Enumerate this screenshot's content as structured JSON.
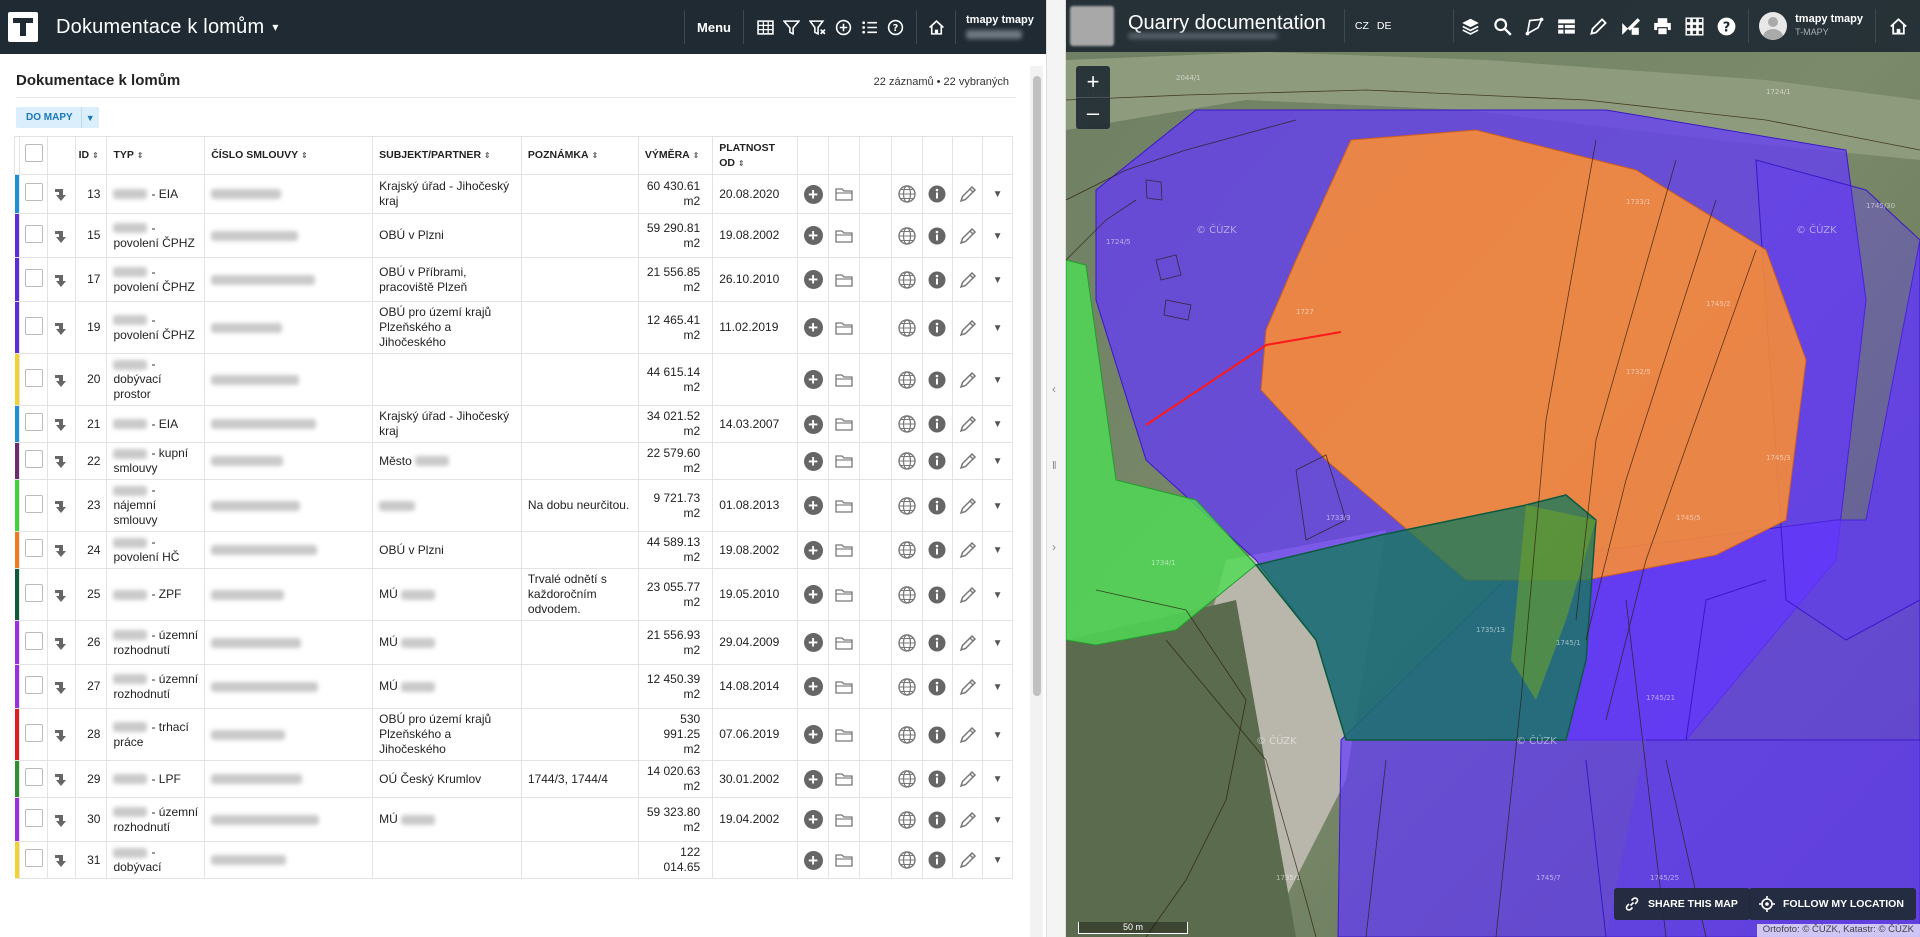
{
  "left_header": {
    "title": "Dokumentace k lomům",
    "menu_label": "Menu",
    "user_name": "tmapy tmapy"
  },
  "list": {
    "title": "Dokumentace k lomům",
    "count": "22 záznamů • 22 vybraných",
    "to_map_button": "DO MAPY"
  },
  "table": {
    "headers": {
      "id": "ID",
      "typ": "TYP",
      "cislo": "ČÍSLO SMLOUVY",
      "subjekt": "SUBJEKT/PARTNER",
      "poznamka": "POZNÁMKA",
      "vymera": "VÝMĚRA",
      "platnost": "PLATNOST OD"
    },
    "rows": [
      {
        "color": "#1e8ed6",
        "id": "13",
        "typ": "- EIA",
        "subjekt": "Krajský úřad - Jihočeský kraj",
        "poznamka": "",
        "vymera": "60 430.61 m2",
        "platnost": "20.08.2020"
      },
      {
        "color": "#5b2dd8",
        "id": "15",
        "typ": "- povolení ČPHZ",
        "subjekt": "OBÚ v Plzni",
        "poznamka": "",
        "vymera": "59 290.81 m2",
        "platnost": "19.08.2002"
      },
      {
        "color": "#5b2dd8",
        "id": "17",
        "typ": "- povolení ČPHZ",
        "subjekt": "OBÚ v Příbrami, pracoviště Plzeň",
        "poznamka": "",
        "vymera": "21 556.85 m2",
        "platnost": "26.10.2010"
      },
      {
        "color": "#5b2dd8",
        "id": "19",
        "typ": "- povolení ČPHZ",
        "subjekt": "OBÚ pro území krajů Plzeňského a Jihočeského",
        "poznamka": "",
        "vymera": "12 465.41 m2",
        "platnost": "11.02.2019"
      },
      {
        "color": "#f2d22e",
        "id": "20",
        "typ": "- dobývací prostor",
        "subjekt": "",
        "poznamka": "",
        "vymera": "44 615.14 m2",
        "platnost": ""
      },
      {
        "color": "#1e8ed6",
        "id": "21",
        "typ": "- EIA",
        "subjekt": "Krajský úřad - Jihočeský kraj",
        "poznamka": "",
        "vymera": "34 021.52 m2",
        "platnost": "14.03.2007"
      },
      {
        "color": "#6b2b6e",
        "id": "22",
        "typ": "- kupní smlouvy",
        "subjekt": "Město",
        "poznamka": "",
        "vymera": "22 579.60 m2",
        "platnost": ""
      },
      {
        "color": "#3fd23a",
        "id": "23",
        "typ": "- nájemní smlouvy",
        "subjekt": "",
        "poznamka": "Na dobu neurčitou.",
        "vymera": "9 721.73 m2",
        "platnost": "01.08.2013"
      },
      {
        "color": "#f07a1e",
        "id": "24",
        "typ": "- povolení HČ",
        "subjekt": "OBÚ v Plzni",
        "poznamka": "",
        "vymera": "44 589.13 m2",
        "platnost": "19.08.2002"
      },
      {
        "color": "#0f5a3a",
        "id": "25",
        "typ": "- ZPF",
        "subjekt": "MÚ",
        "poznamka": "Trvalé odnětí s každoročním odvodem.",
        "vymera": "23 055.77 m2",
        "platnost": "19.05.2010"
      },
      {
        "color": "#9b2ee0",
        "id": "26",
        "typ": "- územní rozhodnutí",
        "subjekt": "MÚ",
        "poznamka": "",
        "vymera": "21 556.93 m2",
        "platnost": "29.04.2009"
      },
      {
        "color": "#9b2ee0",
        "id": "27",
        "typ": "- územní rozhodnutí",
        "subjekt": "MÚ",
        "poznamka": "",
        "vymera": "12 450.39 m2",
        "platnost": "14.08.2014"
      },
      {
        "color": "#e11c1c",
        "id": "28",
        "typ": "- trhací práce",
        "subjekt": "OBÚ pro území krajů Plzeňského a Jihočeského",
        "poznamka": "",
        "vymera": "530 991.25 m2",
        "platnost": "07.06.2019"
      },
      {
        "color": "#2e8f2e",
        "id": "29",
        "typ": "- LPF",
        "subjekt": "OÚ Český Krumlov",
        "poznamka": "1744/3, 1744/4",
        "vymera": "14 020.63 m2",
        "platnost": "30.01.2002"
      },
      {
        "color": "#9b2ee0",
        "id": "30",
        "typ": "- územní rozhodnutí",
        "subjekt": "MÚ",
        "poznamka": "",
        "vymera": "59 323.80 m2",
        "platnost": "19.04.2002"
      },
      {
        "color": "#f2d22e",
        "id": "31",
        "typ": "- dobývací",
        "subjekt": "",
        "poznamka": "",
        "vymera": "122 014.65",
        "platnost": ""
      }
    ]
  },
  "map_header": {
    "title": "Quarry documentation",
    "lang_cz": "CZ",
    "lang_de": "DE",
    "user_name": "tmapy tmapy",
    "org": "T-MAPY"
  },
  "map": {
    "zoom_in": "+",
    "zoom_out": "–",
    "share_button": "SHARE THIS MAP",
    "follow_button": "FOLLOW MY LOCATION",
    "scale": "50 m",
    "attribution": "Ortofoto: © ČÚZK, Katastr: © ČÚZK",
    "watermark": "© ČÚZK"
  },
  "colors": {
    "header_bg": "#1f2a33",
    "purple_area": "#6236ff",
    "orange_area": "#ff8f2e",
    "green_area": "#4fdc56",
    "teal_area": "#157a5c"
  }
}
